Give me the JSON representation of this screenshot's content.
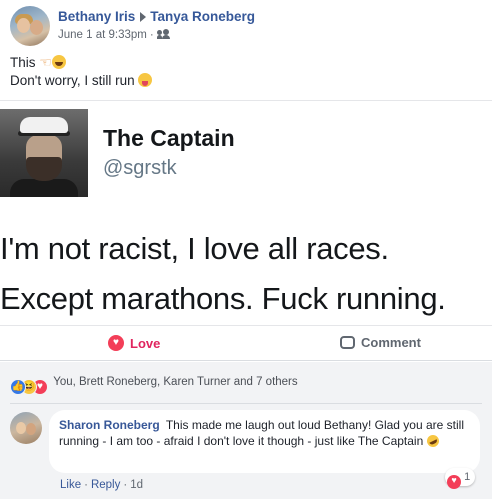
{
  "post": {
    "author": "Bethany Iris",
    "recipient": "Tanya Roneberg",
    "timestamp": "June 1 at 9:33pm",
    "meta_separator": "·",
    "audience_icon": "friends-icon",
    "line1": "This",
    "line2": "Don't worry, I still run"
  },
  "tweet": {
    "name": "The Captain",
    "handle": "@sgrstk",
    "line1": "I'm not racist, I love all races.",
    "line2": "Except marathons. Fuck running."
  },
  "actions": {
    "love_label": "Love",
    "comment_label": "Comment",
    "love_color": "#e0245e"
  },
  "reactions": {
    "summary": "You, Brett Roneberg, Karen Turner and 7 others",
    "like_glyph": "👍",
    "haha_glyph": "😆",
    "love_glyph": "♥"
  },
  "comment": {
    "author": "Sharon Roneberg",
    "text": "This made me laugh out loud Bethany! Glad you are still running - I am too - afraid I don't love it though - just like The Captain",
    "reaction_count": "1",
    "like_label": "Like",
    "reply_label": "Reply",
    "separator": "·",
    "age": "1d"
  },
  "colors": {
    "link_blue": "#365899",
    "footer_bg": "#f2f3f5"
  }
}
